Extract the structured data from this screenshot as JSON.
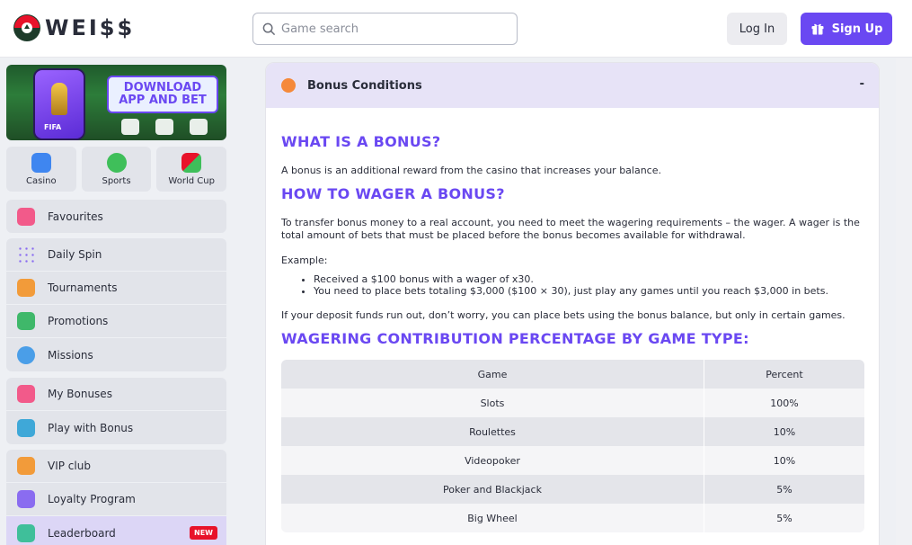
{
  "header": {
    "logo_text": "WEI$$",
    "search_placeholder": "Game search",
    "login_label": "Log In",
    "signup_label": "Sign Up"
  },
  "banner": {
    "line1": "DOWNLOAD",
    "line2": "APP AND BET",
    "badge": "FIFA"
  },
  "categories": [
    {
      "label": "Casino"
    },
    {
      "label": "Sports"
    },
    {
      "label": "World Cup"
    }
  ],
  "sidebar": {
    "group1": [
      {
        "label": "Favourites"
      }
    ],
    "group2": [
      {
        "label": "Daily Spin"
      },
      {
        "label": "Tournaments"
      },
      {
        "label": "Promotions"
      },
      {
        "label": "Missions"
      }
    ],
    "group3": [
      {
        "label": "My Bonuses"
      },
      {
        "label": "Play with Bonus"
      }
    ],
    "group4": [
      {
        "label": "VIP club"
      },
      {
        "label": "Loyalty Program"
      },
      {
        "label": "Leaderboard",
        "badge": "NEW"
      }
    ]
  },
  "panel": {
    "title": "Bonus Conditions",
    "collapse_symbol": "-",
    "h1": "WHAT IS A BONUS?",
    "p1": "A bonus is an additional reward from the casino that increases your balance.",
    "h2": "HOW TO WAGER A BONUS?",
    "p2": "To transfer bonus money to a real account, you need to meet the wagering requirements – the wager. A wager is the total amount of bets that must be placed before the bonus becomes available for withdrawal.",
    "example_label": "Example:",
    "bullets": [
      "Received a $100 bonus with a wager of x30.",
      "You need to place bets totaling $3,000 ($100 × 30), just play any games until you reach $3,000 in bets."
    ],
    "p3": "If your deposit funds run out, don’t worry, you can place bets using the bonus balance, but only in certain games.",
    "h3": "WAGERING CONTRIBUTION PERCENTAGE BY GAME TYPE:",
    "table": {
      "headers": [
        "Game",
        "Percent"
      ],
      "rows": [
        [
          "Slots",
          "100%"
        ],
        [
          "Roulettes",
          "10%"
        ],
        [
          "Videopoker",
          "10%"
        ],
        [
          "Poker and Blackjack",
          "5%"
        ],
        [
          "Big Wheel",
          "5%"
        ]
      ]
    }
  },
  "colors": {
    "accent": "#6a48f2",
    "dot": "#f5893a",
    "new_badge": "#e8122a"
  }
}
